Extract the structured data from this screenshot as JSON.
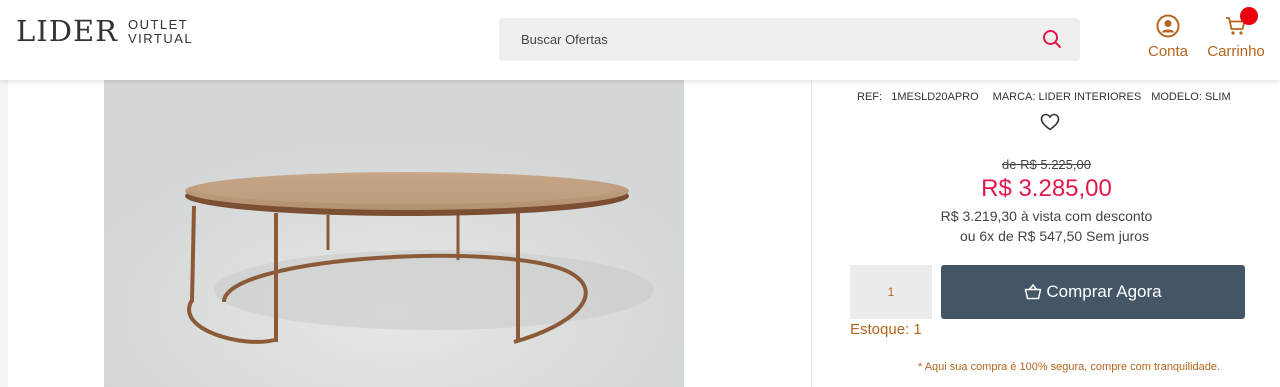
{
  "header": {
    "logo_main": "LIDER",
    "logo_sub_1": "OUTLET",
    "logo_sub_2": "VIRTUAL",
    "search_placeholder": "Buscar Ofertas",
    "account_label": "Conta",
    "cart_label": "Carrinho"
  },
  "product": {
    "ref": "REF:   1MESLD20APRO",
    "brand": "MARCA: LIDER INTERIORES",
    "model": "MODELO: SLIM",
    "old_price": "de R$ 5.225,00",
    "price": "R$ 3.285,00",
    "cash_price": "R$ 3.219,30 à vista com desconto",
    "installments": "ou 6x de R$ 547,50 Sem juros",
    "quantity": "1",
    "buy_label": "Comprar Agora",
    "stock": "Estoque: 1",
    "secure_note": "* Aqui sua compra é 100% segura, compre com tranquilidade."
  },
  "colors": {
    "accent": "#b5651d",
    "price": "#e0194a",
    "button": "#445565",
    "badge": "#e8000f"
  },
  "icons": {
    "search": "search-icon",
    "account": "user-circle-icon",
    "cart": "cart-icon",
    "favorite": "heart-icon",
    "buy": "basket-icon"
  }
}
